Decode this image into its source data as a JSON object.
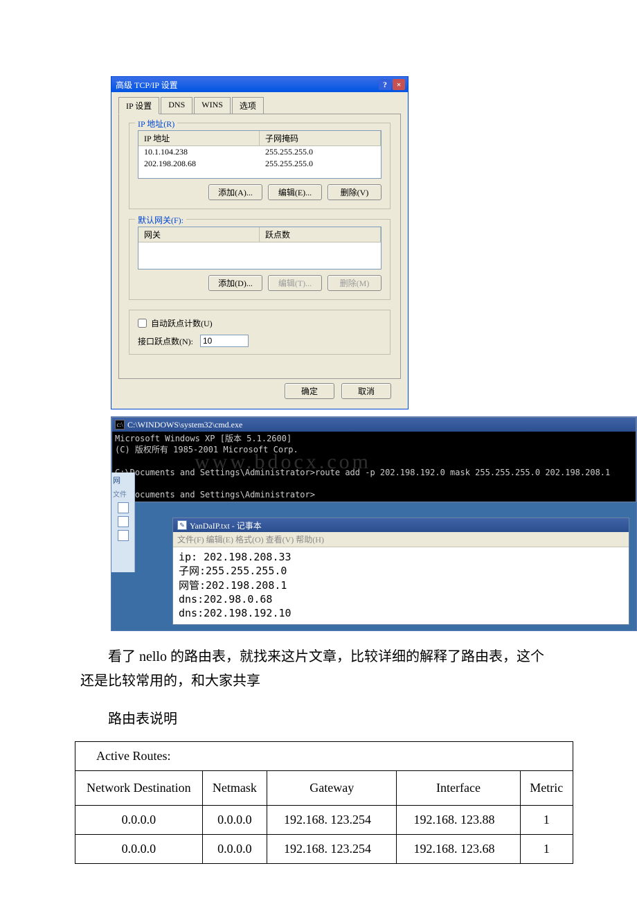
{
  "dialog": {
    "title": "高级 TCP/IP 设置",
    "tabs": {
      "ip": "IP 设置",
      "dns": "DNS",
      "wins": "WINS",
      "options": "选项"
    },
    "ip_section": {
      "legend": "IP 地址(R)",
      "col_ip": "IP 地址",
      "col_mask": "子网掩码",
      "rows": [
        {
          "ip": "10.1.104.238",
          "mask": "255.255.255.0"
        },
        {
          "ip": "202.198.208.68",
          "mask": "255.255.255.0"
        }
      ],
      "add": "添加(A)...",
      "edit": "编辑(E)...",
      "remove": "删除(V)"
    },
    "gw_section": {
      "legend": "默认网关(F):",
      "col_gw": "网关",
      "col_metric": "跃点数",
      "add": "添加(D)...",
      "edit": "编辑(T)...",
      "remove": "删除(M)"
    },
    "auto_metric": "自动跃点计数(U)",
    "iface_metric_label": "接口跃点数(N):",
    "iface_metric_value": "10",
    "ok": "确定",
    "cancel": "取消"
  },
  "cmd": {
    "title": "C:\\WINDOWS\\system32\\cmd.exe",
    "body": "Microsoft Windows XP [版本 5.1.2600]\n(C) 版权所有 1985-2001 Microsoft Corp.\n\nC:\\Documents and Settings\\Administrator>route add -p 202.198.192.0 mask 255.255.255.0 202.198.208.1\n\nC:\\Documents and Settings\\Administrator>"
  },
  "sidebar": {
    "item1": "网",
    "item2": "文件"
  },
  "notepad": {
    "title": "YanDaIP.txt - 记事本",
    "menu": "文件(F)  编辑(E)  格式(O)  查看(V)  帮助(H)",
    "body": "ip: 202.198.208.33\n子网:255.255.255.0\n网管:202.198.208.1\ndns:202.98.0.68\ndns:202.198.192.10"
  },
  "watermark": "www.bdocx.com",
  "para1": "看了 nello 的路由表，就找来这片文章，比较详细的解释了路由表，这个还是比较常用的，和大家共享",
  "para2": "路由表说明",
  "route_table": {
    "active": "Active Routes:",
    "headers": {
      "nd": "Network Destination",
      "nm": "Netmask",
      "gw": "Gateway",
      "if": "Interface",
      "m": "Metric"
    },
    "rows": [
      {
        "nd": "0.0.0.0",
        "nm": "0.0.0.0",
        "gw": "192.168. 123.254",
        "if": "192.168. 123.88",
        "m": "1"
      },
      {
        "nd": "0.0.0.0",
        "nm": "0.0.0.0",
        "gw": "192.168. 123.254",
        "if": "192.168. 123.68",
        "m": "1"
      }
    ]
  }
}
